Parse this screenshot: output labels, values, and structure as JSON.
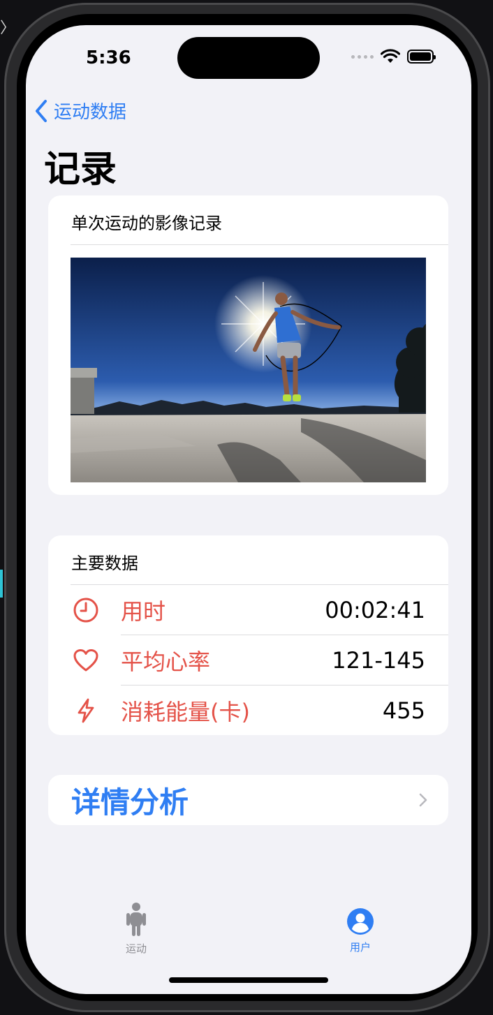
{
  "status": {
    "time": "5:36"
  },
  "nav": {
    "back_label": "运动数据",
    "title": "记录"
  },
  "photo_card": {
    "header": "单次运动的影像记录"
  },
  "main_card": {
    "header": "主要数据",
    "rows": [
      {
        "label": "用时",
        "value": "00:02:41",
        "icon": "clock-icon"
      },
      {
        "label": "平均心率",
        "value": "121-145",
        "icon": "heart-icon"
      },
      {
        "label": "消耗能量(卡)",
        "value": "455",
        "icon": "bolt-icon"
      }
    ]
  },
  "detail": {
    "label": "详情分析"
  },
  "tabbar": {
    "tabs": [
      {
        "label": "运动",
        "icon": "figure-icon"
      },
      {
        "label": "用户",
        "icon": "person-circle-icon"
      }
    ]
  },
  "colors": {
    "accent": "#2f7ef3",
    "metric": "#e45248",
    "background": "#f2f2f7"
  }
}
